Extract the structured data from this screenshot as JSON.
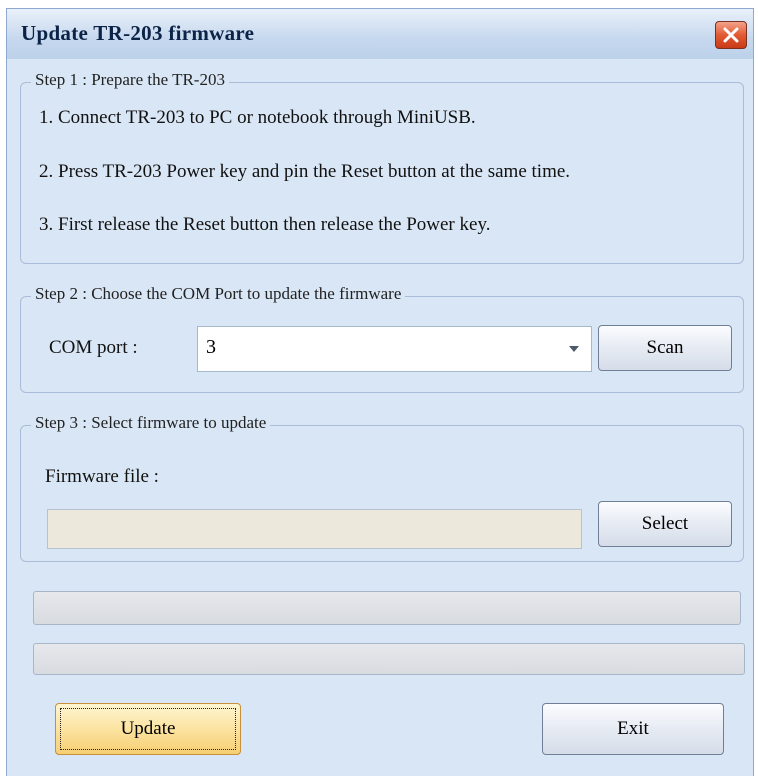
{
  "window": {
    "title": "Update TR-203 firmware"
  },
  "step1": {
    "legend": "Step 1 : Prepare the TR-203",
    "lines": [
      "1. Connect TR-203 to PC or notebook through MiniUSB.",
      "2. Press TR-203 Power key and  pin the Reset button at the same time.",
      "3. First release the Reset button  then release the Power key."
    ]
  },
  "step2": {
    "legend": "Step 2 : Choose the COM Port to update the firmware",
    "com_label": "COM port :",
    "com_value": "3",
    "scan_label": "Scan"
  },
  "step3": {
    "legend": "Step 3 : Select firmware to update",
    "file_label": "Firmware file :",
    "file_value": "",
    "select_label": "Select"
  },
  "footer": {
    "update_label": "Update",
    "exit_label": "Exit"
  },
  "icons": {
    "close": "close-icon",
    "dropdown": "chevron-down-icon"
  },
  "colors": {
    "window_bg": "#d9e6f5",
    "close_red": "#e25a33",
    "update_button": "#fbe3a1"
  }
}
